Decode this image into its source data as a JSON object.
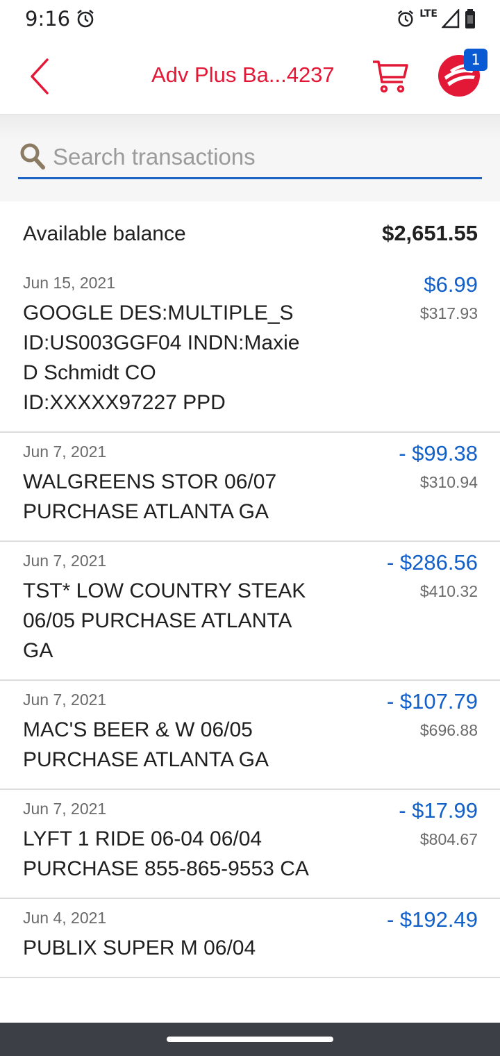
{
  "status_bar": {
    "time": "9:16",
    "network": "LTE"
  },
  "header": {
    "title": "Adv Plus Ba...4237",
    "notification_count": "1",
    "brand_color": "#e31837"
  },
  "search": {
    "placeholder": "Search transactions",
    "value": ""
  },
  "balance": {
    "label": "Available balance",
    "value": "$2,651.55"
  },
  "transactions": [
    {
      "date": "Jun 15, 2021",
      "description": "GOOGLE DES:MULTIPLE_S ID:US003GGF04 INDN:Maxie D Schmidt CO ID:XXXXX97227 PPD",
      "amount": "$6.99",
      "running_balance": "$317.93"
    },
    {
      "date": "Jun 7, 2021",
      "description": "WALGREENS STOR 06/07 PURCHASE ATLANTA GA",
      "amount": "- $99.38",
      "running_balance": "$310.94"
    },
    {
      "date": "Jun 7, 2021",
      "description": "TST* LOW COUNTRY STEAK 06/05 PURCHASE ATLANTA GA",
      "amount": "- $286.56",
      "running_balance": "$410.32"
    },
    {
      "date": "Jun 7, 2021",
      "description": "MAC'S BEER & W 06/05 PURCHASE ATLANTA GA",
      "amount": "- $107.79",
      "running_balance": "$696.88"
    },
    {
      "date": "Jun 7, 2021",
      "description": "LYFT 1 RIDE 06-04 06/04 PURCHASE 855-865-9553 CA",
      "amount": "- $17.99",
      "running_balance": "$804.67"
    },
    {
      "date": "Jun 4, 2021",
      "description": "PUBLIX SUPER M 06/04",
      "amount": "- $192.49",
      "running_balance": ""
    }
  ]
}
